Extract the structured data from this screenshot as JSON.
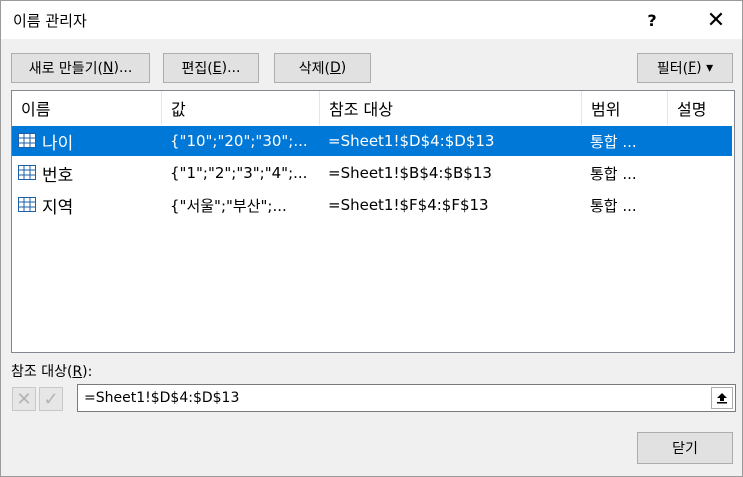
{
  "window": {
    "title": "이름 관리자",
    "help_label": "?",
    "close_label": "✕"
  },
  "toolbar": {
    "new_label": "새로 만들기(",
    "new_key": "N",
    "new_suffix": ")...",
    "edit_label": "편집(",
    "edit_key": "E",
    "edit_suffix": ")...",
    "delete_label": "삭제(",
    "delete_key": "D",
    "delete_suffix": ")",
    "filter_label": "필터(",
    "filter_key": "F",
    "filter_suffix": ") ▾"
  },
  "table": {
    "headers": [
      "이름",
      "값",
      "참조 대상",
      "범위",
      "설명"
    ],
    "rows": [
      {
        "name": "나이",
        "value": "{\"10\";\"20\";\"30\";...",
        "refers_to": "=Sheet1!$D$4:$D$13",
        "scope": "통합 ...",
        "selected": true
      },
      {
        "name": "번호",
        "value": "{\"1\";\"2\";\"3\";\"4\";...",
        "refers_to": "=Sheet1!$B$4:$B$13",
        "scope": "통합 ...",
        "selected": false
      },
      {
        "name": "지역",
        "value": "{\"서울\";\"부산\";...",
        "refers_to": "=Sheet1!$F$4:$F$13",
        "scope": "통합 ...",
        "selected": false
      }
    ]
  },
  "scrollbar": {
    "left_arrow": "<",
    "right_arrow": ">"
  },
  "reference": {
    "label": "참조 대상(",
    "label_key": "R",
    "label_suffix": "):",
    "value": "=Sheet1!$D$4:$D$13",
    "cancel_glyph": "✕",
    "confirm_glyph": "✓"
  },
  "footer": {
    "close_label": "닫기"
  },
  "colors": {
    "selection": "#0078d7",
    "icon_blue": "#1e5fa8"
  }
}
